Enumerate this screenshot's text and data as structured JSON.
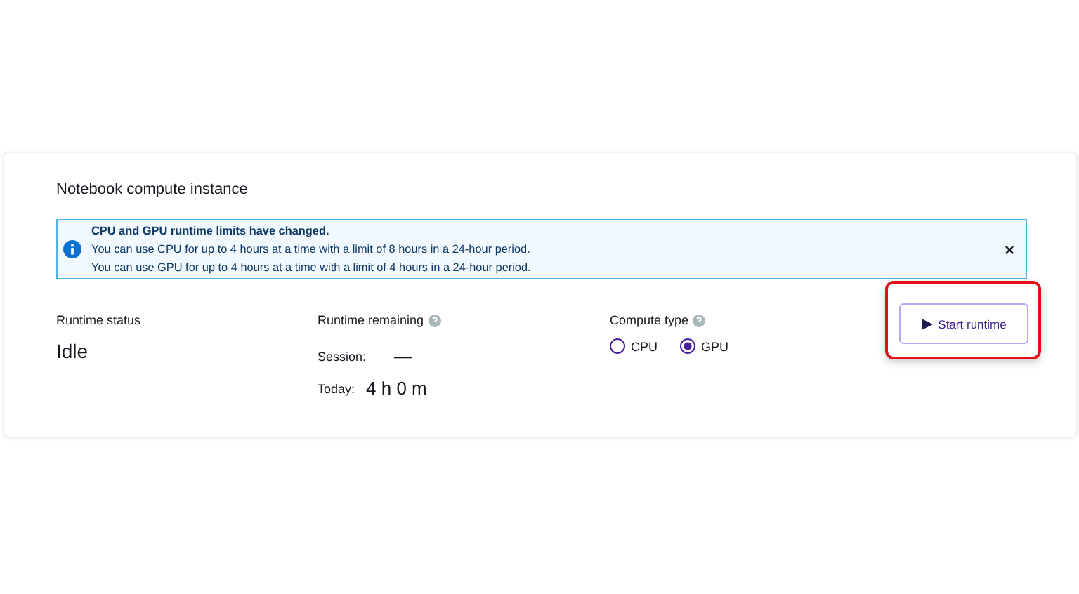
{
  "title": "Notebook compute instance",
  "alert": {
    "heading": "CPU and GPU runtime limits have changed.",
    "lines": [
      "You can use CPU for up to 4 hours at a time with a limit of 8 hours in a 24-hour period.",
      "You can use GPU for up to 4 hours at a time with a limit of 4 hours in a 24-hour period."
    ],
    "close": "×"
  },
  "status": {
    "label": "Runtime status",
    "value": "Idle"
  },
  "remaining": {
    "label": "Runtime remaining",
    "session_label": "Session:",
    "session_value": "—",
    "today_label": "Today:",
    "today_value": "4 h 0 m"
  },
  "compute_type": {
    "label": "Compute type",
    "options": [
      {
        "label": "CPU",
        "selected": false
      },
      {
        "label": "GPU",
        "selected": true
      }
    ]
  },
  "button": {
    "label": "Start runtime",
    "highlighted": true
  }
}
